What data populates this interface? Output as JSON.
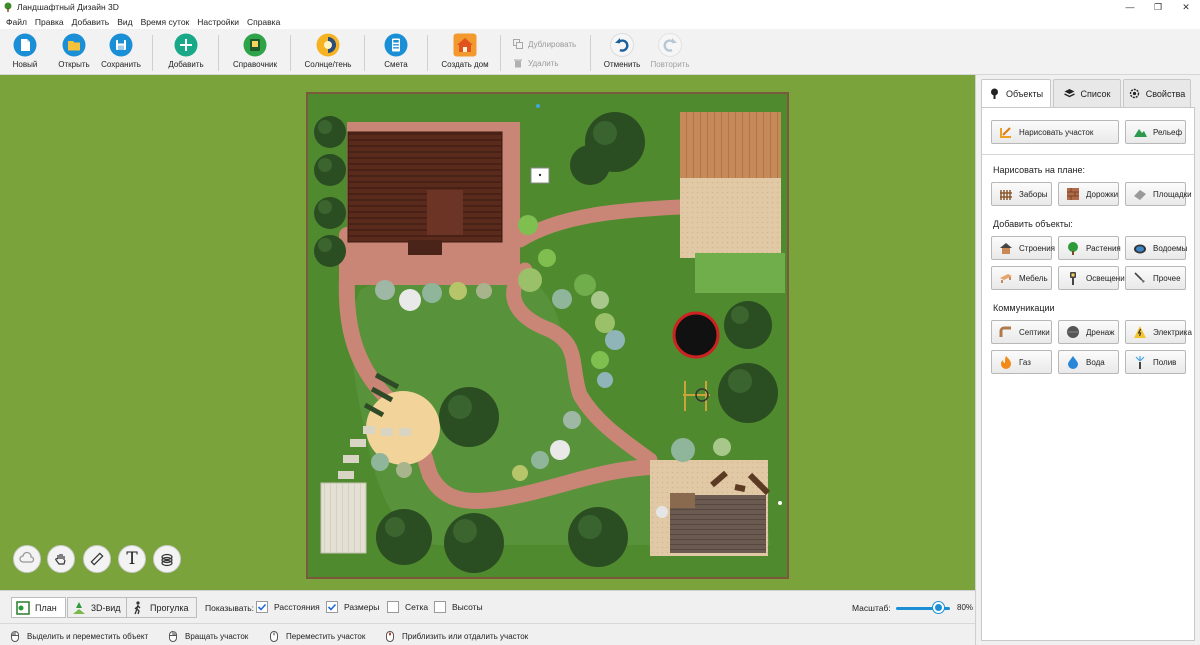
{
  "window": {
    "title": "Ландшафтный Дизайн 3D",
    "minimize": "—",
    "maximize": "❐",
    "close": "✕"
  },
  "menu": [
    "Файл",
    "Правка",
    "Добавить",
    "Вид",
    "Время суток",
    "Настройки",
    "Справка"
  ],
  "toolbar": {
    "new": "Новый",
    "open": "Открыть",
    "save": "Сохранить",
    "add": "Добавить",
    "reference": "Справочник",
    "sun_shadow": "Солнце/тень",
    "estimate": "Смета",
    "create_house": "Создать дом",
    "duplicate": "Дублировать",
    "delete": "Удалить",
    "undo": "Отменить",
    "redo": "Повторить"
  },
  "panel": {
    "tabs": [
      "Объекты",
      "Список",
      "Свойства"
    ],
    "draw_plot": "Нарисовать участок",
    "relief": "Рельеф",
    "draw_on_plan_label": "Нарисовать на плане:",
    "draw_items": [
      "Заборы",
      "Дорожки",
      "Площадки"
    ],
    "add_objects_label": "Добавить объекты:",
    "object_items": [
      "Строения",
      "Растения",
      "Водоемы",
      "Мебель",
      "Освещение",
      "Прочее"
    ],
    "communications_label": "Коммуникации",
    "communication_items": [
      "Септики",
      "Дренаж",
      "Электрика",
      "Газ",
      "Вода",
      "Полив"
    ]
  },
  "canvas_tools": {
    "text_tool": "T"
  },
  "bottom": {
    "views": [
      "План",
      "3D-вид",
      "Прогулка"
    ],
    "show_label": "Показывать:",
    "checks": [
      {
        "label": "Расстояния",
        "checked": true
      },
      {
        "label": "Размеры",
        "checked": true
      },
      {
        "label": "Сетка",
        "checked": false
      },
      {
        "label": "Высоты",
        "checked": false
      }
    ],
    "zoom_label": "Масштаб:",
    "zoom_value": "80%",
    "zoom_fraction": 0.8
  },
  "status": {
    "hints": [
      "Выделить и переместить объект",
      "Вращать участок",
      "Переместить участок",
      "Приблизить или отдалить участок"
    ]
  },
  "colors": {
    "grass_outer": "#7aa33c",
    "plot_lawn": "#4f8a2e",
    "path": "#c98676",
    "accent": "#1a8fd6"
  }
}
